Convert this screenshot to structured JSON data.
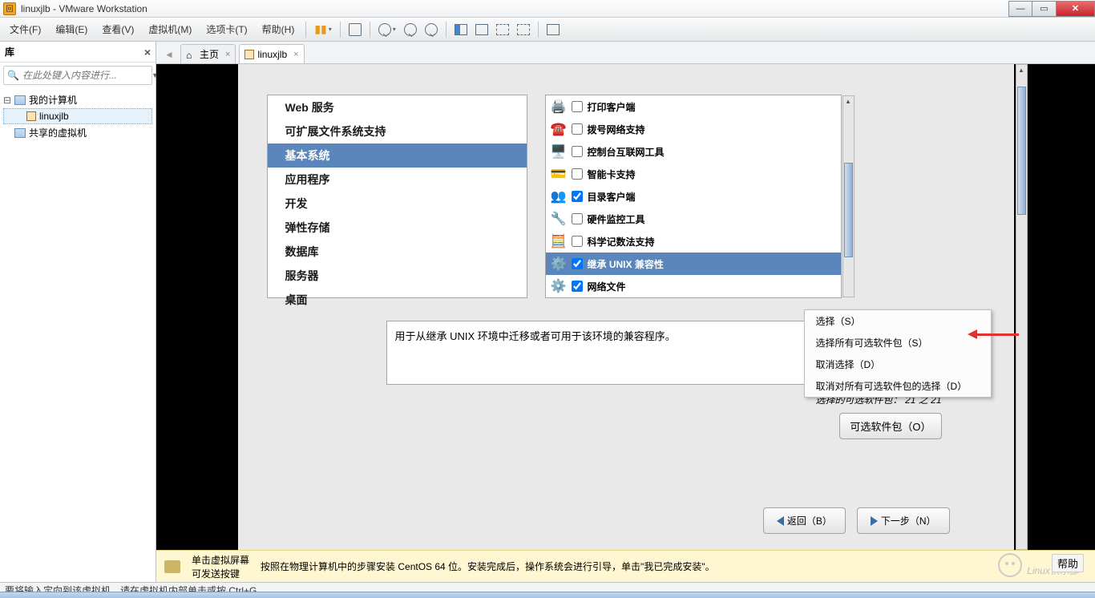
{
  "title": "linuxjlb - VMware Workstation",
  "menu": {
    "file": "文件(F)",
    "edit": "编辑(E)",
    "view": "查看(V)",
    "vm": "虚拟机(M)",
    "tabs": "选项卡(T)",
    "help": "帮助(H)"
  },
  "sidebar": {
    "title": "库",
    "search_placeholder": "在此处键入内容进行...",
    "nodes": {
      "computer": "我的计算机",
      "vm": "linuxjlb",
      "shared": "共享的虚拟机"
    }
  },
  "tabs": {
    "home": "主页",
    "vm": "linuxjlb"
  },
  "installer": {
    "categories": [
      "Web 服务",
      "可扩展文件系统支持",
      "基本系统",
      "应用程序",
      "开发",
      "弹性存储",
      "数据库",
      "服务器",
      "桌面"
    ],
    "selected_category_index": 2,
    "packages": [
      {
        "label": "打印客户端",
        "checked": false
      },
      {
        "label": "拨号网络支持",
        "checked": false
      },
      {
        "label": "控制台互联网工具",
        "checked": false
      },
      {
        "label": "智能卡支持",
        "checked": false
      },
      {
        "label": "目录客户端",
        "checked": true
      },
      {
        "label": "硬件监控工具",
        "checked": false
      },
      {
        "label": "科学记数法支持",
        "checked": false
      },
      {
        "label": "继承 UNIX 兼容性",
        "checked": true,
        "selected": true
      },
      {
        "label": "网络文件",
        "checked": true,
        "partial": true
      }
    ],
    "icons": [
      "🖨️",
      "☎️",
      "🖥️",
      "💳",
      "👥",
      "🔧",
      "🧮",
      "⚙️",
      "⚙️"
    ],
    "ctx": {
      "i1": "选择（S）",
      "i2": "选择所有可选软件包（S）",
      "i3": "取消选择（D）",
      "i4": "取消对所有可选软件包的选择（D）"
    },
    "desc": "用于从继承 UNIX 环境中迁移或者可用于该环境的兼容程序。",
    "opt_info_label": "选择的可选软件包：",
    "opt_info_count": "21 之 21",
    "opt_btn": "可选软件包（O）",
    "back": "返回（B）",
    "next": "下一步（N）"
  },
  "infobar": {
    "h1": "单击虚拟屏幕",
    "h2": "可发送按键",
    "msg": "按照在物理计算机中的步骤安装 CentOS 64 位。安装完成后，操作系统会进行引导，单击\"我已完成安装\"。",
    "help": "帮助"
  },
  "watermark": "Linux俱乐部",
  "statusbar": "要将输入定向到该虚拟机，请在虚拟机内部单击或按 Ctrl+G。"
}
